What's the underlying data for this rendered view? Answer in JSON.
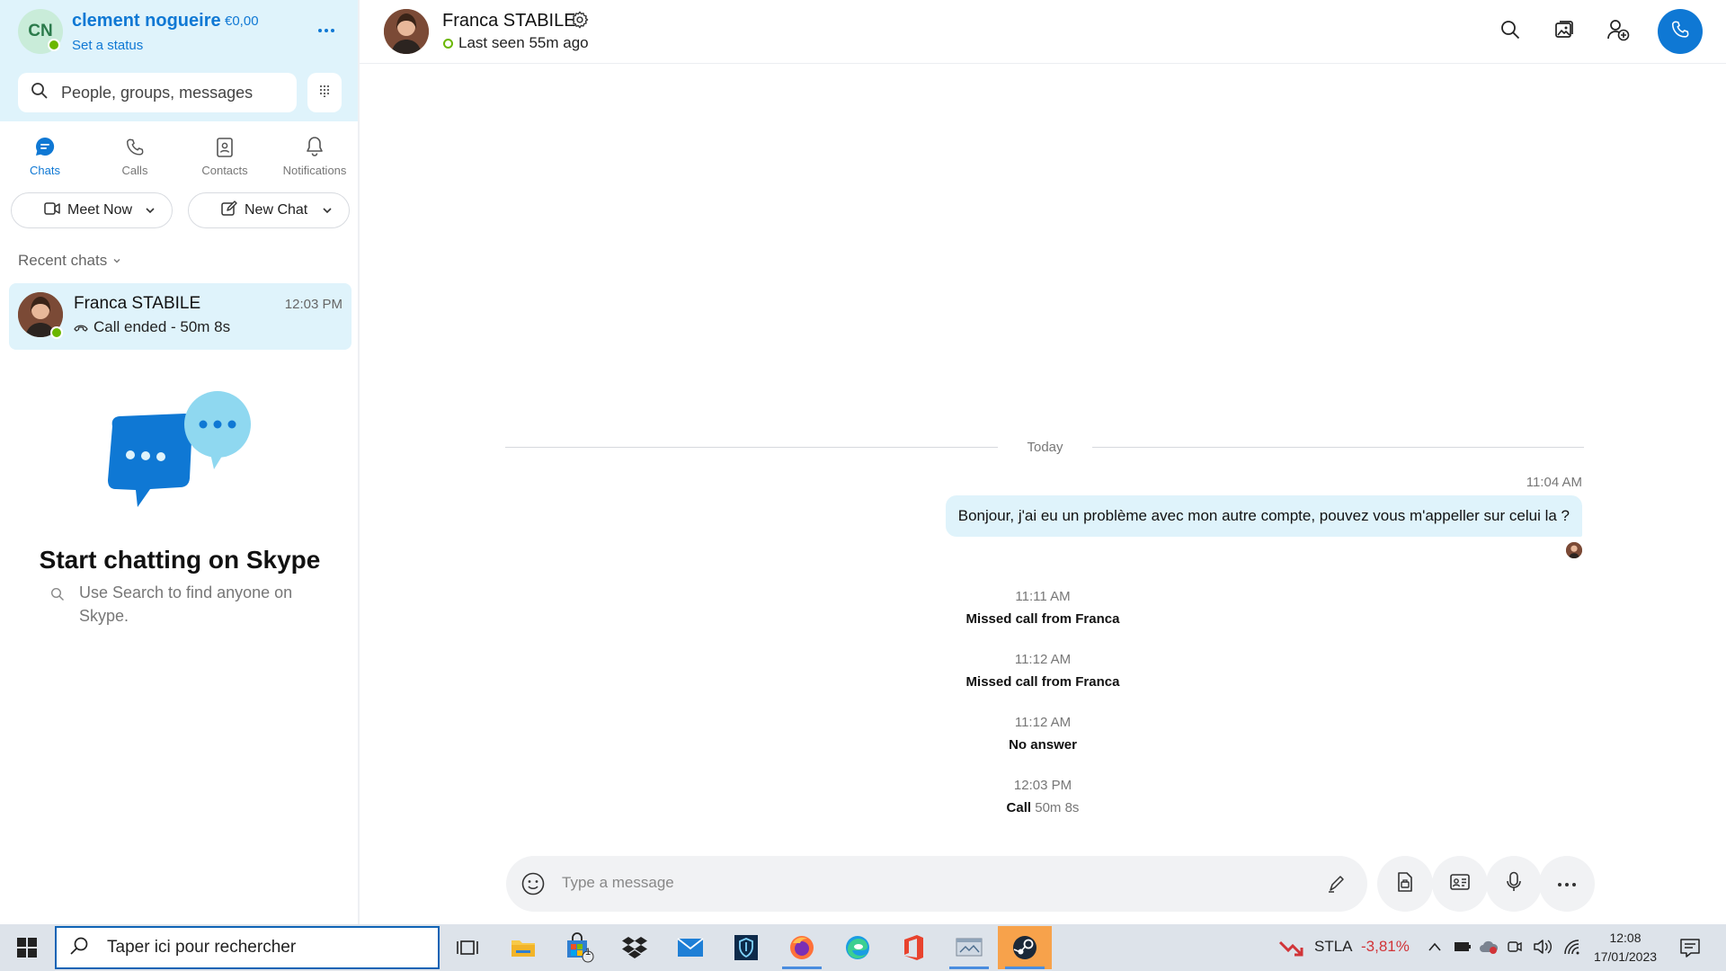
{
  "profile": {
    "initials": "CN",
    "name": "clement nogueire",
    "credit": "€0,00",
    "status": "Set a status"
  },
  "search": {
    "placeholder": "People, groups, messages"
  },
  "nav": {
    "items": [
      {
        "label": "Chats",
        "icon": "chat-icon"
      },
      {
        "label": "Calls",
        "icon": "phone-icon"
      },
      {
        "label": "Contacts",
        "icon": "contacts-icon"
      },
      {
        "label": "Notifications",
        "icon": "bell-icon"
      }
    ]
  },
  "actions": {
    "meet_now": "Meet Now",
    "new_chat": "New Chat"
  },
  "recent": {
    "header": "Recent chats",
    "items": [
      {
        "name": "Franca STABILE",
        "time": "12:03 PM",
        "preview": "Call ended - 50m 8s"
      }
    ]
  },
  "empty_state": {
    "title": "Start chatting on Skype",
    "hint": "Use Search to find anyone on Skype."
  },
  "conversation": {
    "contact_name": "Franca STABILE",
    "last_seen": "Last seen 55m ago",
    "day_separator": "Today",
    "message": {
      "time": "11:04 AM",
      "text": "Bonjour, j'ai eu un problème avec mon autre compte, pouvez vous m'appeller sur celui la ?"
    },
    "events": [
      {
        "time": "11:11 AM",
        "text": "Missed call from Franca"
      },
      {
        "time": "11:12 AM",
        "text": "Missed call from Franca"
      },
      {
        "time": "11:12 AM",
        "text": "No answer"
      },
      {
        "time": "12:03 PM",
        "text": "Call",
        "duration": "50m 8s"
      }
    ]
  },
  "composer": {
    "placeholder": "Type a message"
  },
  "taskbar": {
    "search_placeholder": "Taper ici pour rechercher",
    "store_badge": "1",
    "stock_ticker": "STLA",
    "stock_change": "-3,81%",
    "time": "12:08",
    "date": "17/01/2023"
  },
  "colors": {
    "accent": "#0f78d4",
    "bubble": "#dff3fb",
    "presence": "#6bb700",
    "stock_down": "#d13438"
  }
}
